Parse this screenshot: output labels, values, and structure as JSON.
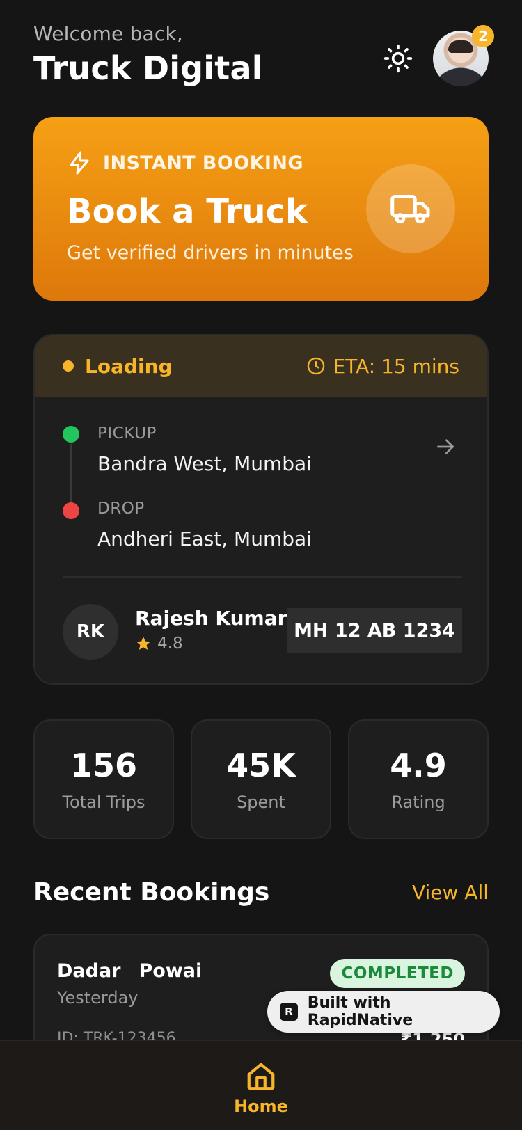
{
  "header": {
    "welcome": "Welcome back,",
    "brand": "Truck Digital",
    "notification_count": "2",
    "theme_icon": "sun-icon"
  },
  "instant_booking": {
    "tag": "INSTANT BOOKING",
    "title": "Book a Truck",
    "subtitle": "Get verified drivers in minutes",
    "icon": "truck-icon",
    "colors": {
      "top": "#f6a015",
      "bottom": "#dd780b"
    }
  },
  "active_trip": {
    "status": "Loading",
    "eta": "ETA: 15 mins",
    "pickup_label": "PICKUP",
    "pickup": "Bandra West, Mumbai",
    "drop_label": "DROP",
    "drop": "Andheri East, Mumbai",
    "driver": {
      "initials": "RK",
      "name": "Rajesh Kumar",
      "rating": "4.8"
    },
    "vehicle_plate": "MH 12 AB 1234"
  },
  "stats": [
    {
      "value": "156",
      "label": "Total Trips"
    },
    {
      "value": "45K",
      "label": "Spent"
    },
    {
      "value": "4.9",
      "label": "Rating"
    }
  ],
  "recent_bookings": {
    "title": "Recent Bookings",
    "view_all": "View All",
    "items": [
      {
        "from": "Dadar",
        "to": "Powai",
        "date": "Yesterday",
        "status": "COMPLETED",
        "id": "ID: TRK-123456",
        "price": "₹1,250"
      }
    ]
  },
  "built_with": "Built with RapidNative",
  "tabbar": {
    "home_label": "Home"
  },
  "colors": {
    "accent": "#f7b52a",
    "background": "#151515",
    "card": "#1e1e1e",
    "pickup_dot": "#22c55e",
    "drop_dot": "#ef4444"
  }
}
